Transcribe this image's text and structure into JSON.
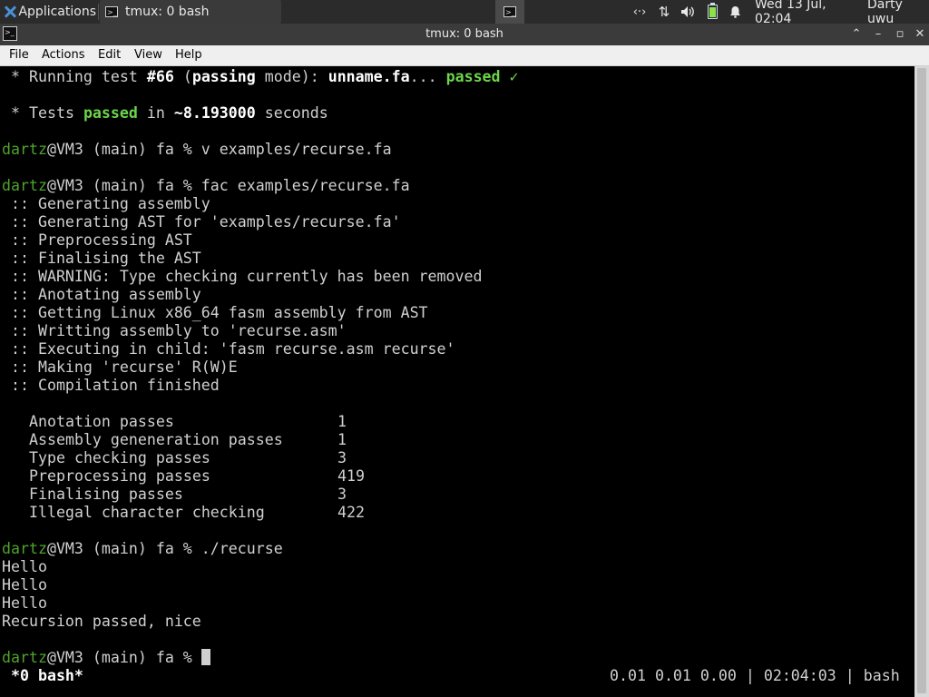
{
  "panel": {
    "applications_label": "Applications",
    "taskbar_item": "tmux: 0 bash",
    "clock": "Wed 13 Jul, 02:04",
    "user": "Darty uwu"
  },
  "window": {
    "title": "tmux: 0 bash",
    "minimize": "⌃",
    "restore": "–",
    "maximize": "▫",
    "close": "✕"
  },
  "menu": {
    "file": "File",
    "actions": "Actions",
    "edit": "Edit",
    "view": "View",
    "help": "Help"
  },
  "terminal": {
    "test_line": {
      "star": " * ",
      "running": "Running test ",
      "num": "#66",
      "paren_open": " (",
      "passing": "passing",
      "mode": " mode): ",
      "file": "unname.fa",
      "dots": "... ",
      "passed": "passed ✓"
    },
    "summary_line": {
      "star": " * ",
      "tests": "Tests ",
      "passed": "passed",
      "in": " in ",
      "time": "~8.193000",
      "seconds": " seconds"
    },
    "prompt_user": "dartz",
    "prompt_rest": "@VM3 (main) fa % ",
    "cmd1": "v examples/recurse.fa",
    "cmd2": "fac examples/recurse.fa",
    "build_lines": [
      " :: Generating assembly",
      " :: Generating AST for 'examples/recurse.fa'",
      " :: Preprocessing AST",
      " :: Finalising the AST",
      " :: WARNING: Type checking currently has been removed",
      " :: Anotating assembly",
      " :: Getting Linux x86_64 fasm assembly from AST",
      " :: Writting assembly to 'recurse.asm'",
      " :: Executing in child: 'fasm recurse.asm recurse'",
      " :: Making 'recurse' R(W)E",
      " :: Compilation finished"
    ],
    "stats": [
      {
        "name": "Anotation passes",
        "value": "1"
      },
      {
        "name": "Assembly geneneration passes",
        "value": "1"
      },
      {
        "name": "Type checking passes",
        "value": "3"
      },
      {
        "name": "Preprocessing passes",
        "value": "419"
      },
      {
        "name": "Finalising passes",
        "value": "3"
      },
      {
        "name": "Illegal character checking",
        "value": "422"
      }
    ],
    "cmd3": "./recurse",
    "output_lines": [
      "Hello",
      "Hello",
      "Hello",
      "Recursion passed, nice"
    ]
  },
  "tmux_status": {
    "window": " *0 bash*",
    "right": "0.01 0.01 0.00 | 02:04:03 | bash"
  },
  "colors": {
    "prompt_user": "#4ea32b",
    "passed_green": "#6cd54b",
    "panel_bg": "#2b2b2b"
  }
}
